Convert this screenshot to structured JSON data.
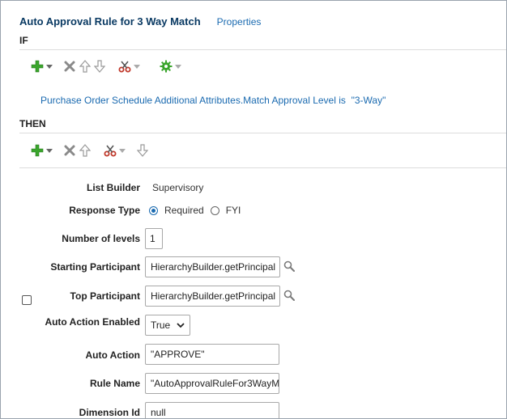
{
  "rule": {
    "title": "Auto Approval Rule for 3 Way Match",
    "properties_link": "Properties"
  },
  "if_section": {
    "label": "IF",
    "condition": {
      "attribute": "Purchase Order Schedule Additional Attributes.Match Approval Level",
      "operator": "is",
      "value": "\"3-Way\""
    }
  },
  "then_section": {
    "label": "THEN"
  },
  "icons": {
    "add": "add-icon",
    "delete": "delete-icon",
    "move_up": "arrow-up-icon",
    "move_down": "arrow-down-icon",
    "cut": "scissors-icon",
    "advanced": "gear-icon"
  },
  "colors": {
    "title": "#0a3a63",
    "link": "#1a6ab0",
    "add_icon": "#3aa52c",
    "cut_icon": "#c0392b",
    "gear_icon": "#3aa52c"
  },
  "form": {
    "list_builder": {
      "label": "List Builder",
      "value": "Supervisory"
    },
    "response_type": {
      "label": "Response Type",
      "options": [
        "Required",
        "FYI"
      ],
      "selected": "Required"
    },
    "number_of_levels": {
      "label": "Number of levels",
      "value": "1"
    },
    "starting_participant": {
      "label": "Starting Participant",
      "value": "HierarchyBuilder.getPrincipal"
    },
    "top_participant": {
      "label": "Top Participant",
      "value": "HierarchyBuilder.getPrincipal"
    },
    "auto_action_enabled": {
      "label": "Auto Action Enabled",
      "value": "True"
    },
    "auto_action": {
      "label": "Auto Action",
      "value": "\"APPROVE\""
    },
    "rule_name": {
      "label": "Rule Name",
      "value": "\"AutoApprovalRuleFor3WayM"
    },
    "dimension_id": {
      "label": "Dimension Id",
      "value": "null"
    }
  }
}
